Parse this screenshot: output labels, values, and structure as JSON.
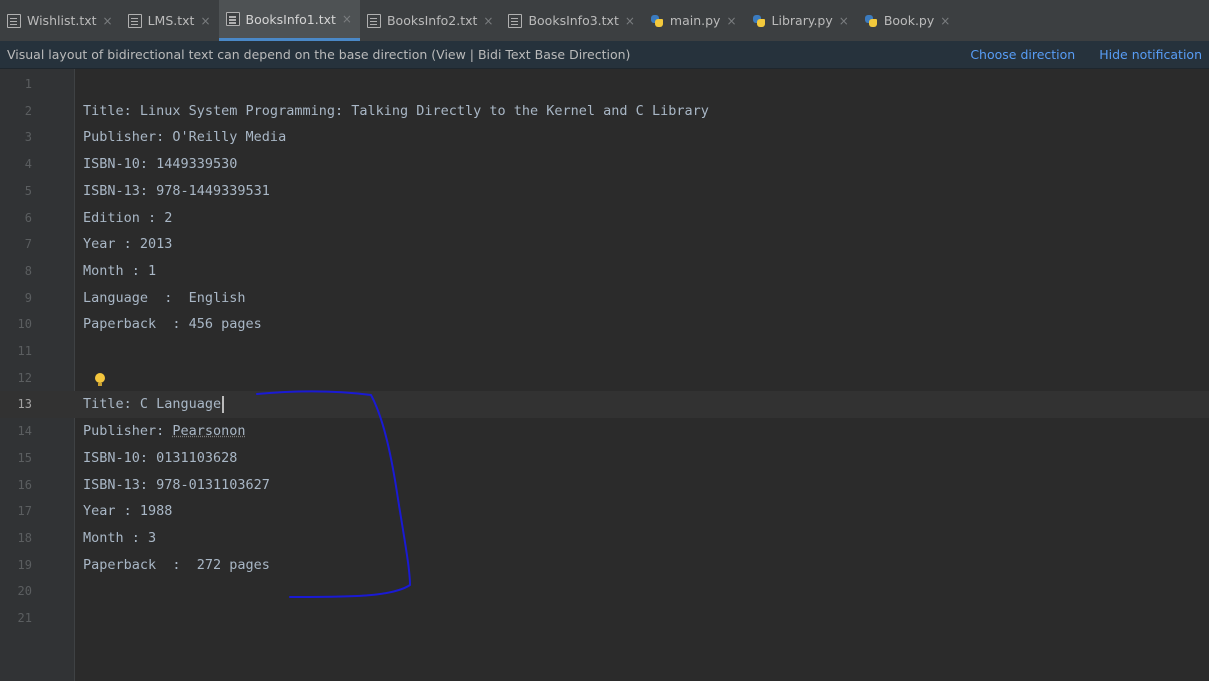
{
  "tabs": [
    {
      "label": "Wishlist.txt",
      "icon": "text-file-icon",
      "active": false
    },
    {
      "label": "LMS.txt",
      "icon": "text-file-icon",
      "active": false
    },
    {
      "label": "BooksInfo1.txt",
      "icon": "text-file-icon",
      "active": true
    },
    {
      "label": "BooksInfo2.txt",
      "icon": "text-file-icon",
      "active": false
    },
    {
      "label": "BooksInfo3.txt",
      "icon": "text-file-icon",
      "active": false
    },
    {
      "label": "main.py",
      "icon": "python-file-icon",
      "active": false
    },
    {
      "label": "Library.py",
      "icon": "python-file-icon",
      "active": false
    },
    {
      "label": "Book.py",
      "icon": "python-file-icon",
      "active": false
    }
  ],
  "close_glyph": "×",
  "notification": {
    "message": "Visual layout of bidirectional text can depend on the base direction (View | Bidi Text Base Direction)",
    "choose_direction": "Choose direction",
    "hide_notification": "Hide notification"
  },
  "editor": {
    "current_line": 13,
    "lines": [
      {
        "num": "1",
        "text": ""
      },
      {
        "num": "2",
        "text": "Title: Linux System Programming: Talking Directly to the Kernel and C Library"
      },
      {
        "num": "3",
        "text": "Publisher: O'Reilly Media"
      },
      {
        "num": "4",
        "text": "ISBN-10: 1449339530"
      },
      {
        "num": "5",
        "text": "ISBN-13: 978-1449339531"
      },
      {
        "num": "6",
        "text": "Edition : 2"
      },
      {
        "num": "7",
        "text": "Year : 2013"
      },
      {
        "num": "8",
        "text": "Month : 1"
      },
      {
        "num": "9",
        "text": "Language  :  English"
      },
      {
        "num": "10",
        "text": "Paperback  : 456 pages"
      },
      {
        "num": "11",
        "text": ""
      },
      {
        "num": "12",
        "text": ""
      },
      {
        "num": "13",
        "text": "Title: C Language"
      },
      {
        "num": "14",
        "text_prefix": "Publisher: ",
        "text_typo": "Pearsonon"
      },
      {
        "num": "15",
        "text": "ISBN-10: 0131103628"
      },
      {
        "num": "16",
        "text": "ISBN-13: 978-0131103627"
      },
      {
        "num": "17",
        "text": "Year : 1988"
      },
      {
        "num": "18",
        "text": "Month : 3"
      },
      {
        "num": "19",
        "text": "Paperback  :  272 pages"
      },
      {
        "num": "20",
        "text": ""
      },
      {
        "num": "21",
        "text": ""
      }
    ]
  },
  "colors": {
    "tab_bar": "#3c3f41",
    "active_tab_underline": "#4a88c7",
    "notification_bg": "#26323c",
    "link": "#589df6",
    "editor_bg": "#2b2b2b",
    "code_text": "#a9b7c6",
    "annotation_ink": "#1a1ad4",
    "intention_bulb": "#f4c63d"
  }
}
